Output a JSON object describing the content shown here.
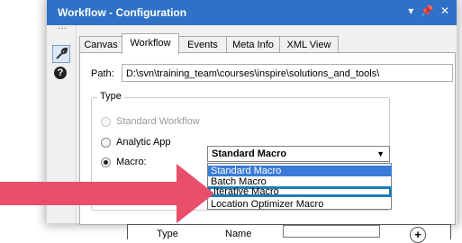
{
  "window": {
    "title": "Workflow - Configuration",
    "controls": [
      "▾",
      "Ⅱ",
      "✕"
    ]
  },
  "tabs": [
    {
      "label": "Canvas",
      "active": false
    },
    {
      "label": "Workflow",
      "active": true
    },
    {
      "label": "Events",
      "active": false
    },
    {
      "label": "Meta Info",
      "active": false
    },
    {
      "label": "XML View",
      "active": false
    }
  ],
  "path": {
    "label": "Path:",
    "value": "D:\\svn\\training_team\\courses\\inspire\\solutions_and_tools\\"
  },
  "type_group": {
    "label": "Type",
    "options": [
      {
        "label": "Standard Workflow",
        "checked": false,
        "enabled": false
      },
      {
        "label": "Analytic App",
        "checked": false,
        "enabled": true
      },
      {
        "label": "Macro:",
        "checked": true,
        "enabled": true
      }
    ]
  },
  "macro_select": {
    "value": "Standard Macro",
    "options": [
      {
        "label": "Standard Macro",
        "selected": true
      },
      {
        "label": "Batch Macro",
        "selected": false
      },
      {
        "label": "Iterative Macro",
        "selected": false,
        "highlighted": true
      },
      {
        "label": "Location Optimizer Macro",
        "selected": false
      }
    ]
  },
  "table": {
    "col_type": "Type",
    "col_name": "Name",
    "col_name2": "Name"
  },
  "icons": {
    "wrench": "wrench-icon",
    "help": "help-icon",
    "add": "plus-circle-icon",
    "arrow": "red-arrow-annotation"
  },
  "colors": {
    "titlebar": "#2e71c7",
    "selection": "#3a7bd5",
    "highlight_border": "#1c7cb8",
    "arrow": "#e94e6a"
  }
}
